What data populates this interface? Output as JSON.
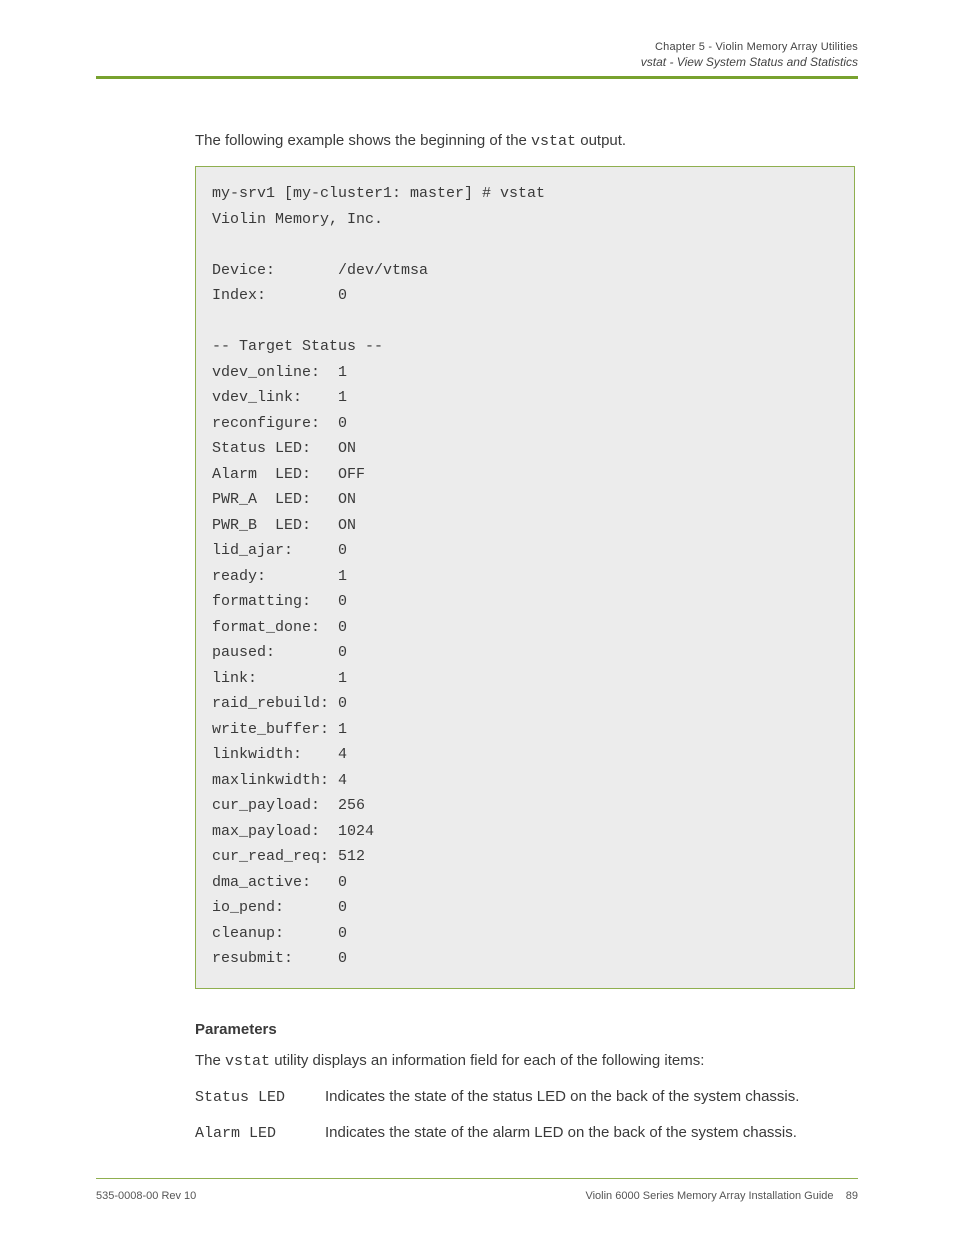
{
  "header": {
    "chapter": "Chapter 5 - Violin Memory Array Utilities",
    "section": "vstat - View System Status and Statistics"
  },
  "intro": {
    "prefix": "The following example shows the beginning of the ",
    "cmd": "vstat",
    "suffix": " output."
  },
  "code": "my-srv1 [my-cluster1: master] # vstat\nViolin Memory, Inc.\n\nDevice:       /dev/vtmsa\nIndex:        0\n\n-- Target Status --\nvdev_online:  1\nvdev_link:    1\nreconfigure:  0\nStatus LED:   ON\nAlarm  LED:   OFF\nPWR_A  LED:   ON\nPWR_B  LED:   ON\nlid_ajar:     0\nready:        1\nformatting:   0\nformat_done:  0\npaused:       0\nlink:         1\nraid_rebuild: 0\nwrite_buffer: 1\nlinkwidth:    4\nmaxlinkwidth: 4\ncur_payload:  256\nmax_payload:  1024\ncur_read_req: 512\ndma_active:   0\nio_pend:      0\ncleanup:      0\nresubmit:     0",
  "parameters": {
    "heading": "Parameters",
    "intro_prefix": "The ",
    "intro_cmd": "vstat",
    "intro_suffix": " utility displays an information field for each of the following items:",
    "items": [
      {
        "label": "Status LED",
        "desc": "Indicates the state of the status LED on the back of the system chassis."
      },
      {
        "label": "Alarm LED",
        "desc": "Indicates the state of the alarm LED on the back of the system chassis."
      }
    ]
  },
  "footer": {
    "left": "535-0008-00 Rev 10",
    "right": "Violin 6000 Series Memory Array Installation Guide",
    "page": "89"
  }
}
